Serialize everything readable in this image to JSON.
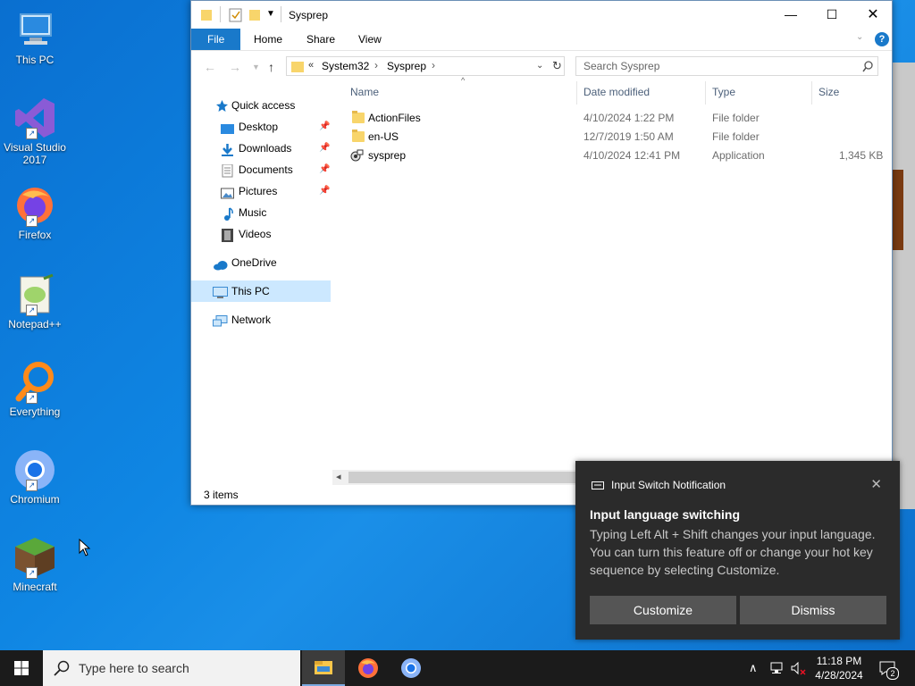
{
  "desktop": {
    "icons": [
      {
        "label": "This PC"
      },
      {
        "label": "Visual Studio 2017"
      },
      {
        "label": "Firefox"
      },
      {
        "label": "Notepad++"
      },
      {
        "label": "Everything"
      },
      {
        "label": "Chromium"
      },
      {
        "label": "Minecraft"
      }
    ]
  },
  "explorer": {
    "title": "Sysprep",
    "ribbon_tabs": [
      "File",
      "Home",
      "Share",
      "View"
    ],
    "breadcrumb": {
      "overflow": "«",
      "parts": [
        "System32",
        "Sysprep"
      ]
    },
    "search_placeholder": "Search Sysprep",
    "nav": {
      "quick_access": "Quick access",
      "items": [
        "Desktop",
        "Downloads",
        "Documents",
        "Pictures",
        "Music",
        "Videos"
      ],
      "onedrive": "OneDrive",
      "this_pc": "This PC",
      "network": "Network"
    },
    "columns": [
      "Name",
      "Date modified",
      "Type",
      "Size"
    ],
    "files": [
      {
        "name": "ActionFiles",
        "date": "4/10/2024 1:22 PM",
        "type": "File folder",
        "size": ""
      },
      {
        "name": "en-US",
        "date": "12/7/2019 1:50 AM",
        "type": "File folder",
        "size": ""
      },
      {
        "name": "sysprep",
        "date": "4/10/2024 12:41 PM",
        "type": "Application",
        "size": "1,345 KB"
      }
    ],
    "status": "3 items"
  },
  "notification": {
    "app": "Input Switch Notification",
    "heading": "Input language switching",
    "body": "Typing Left Alt + Shift changes your input language. You can turn this feature off or change your hot key sequence by selecting Customize.",
    "buttons": {
      "customize": "Customize",
      "dismiss": "Dismiss"
    }
  },
  "taskbar": {
    "search_placeholder": "Type here to search",
    "time": "11:18 PM",
    "date": "4/28/2024",
    "notification_count": "2"
  },
  "colors": {
    "accent": "#1979ca",
    "taskbar": "#1b1b1b",
    "toast": "#2b2b2b"
  }
}
